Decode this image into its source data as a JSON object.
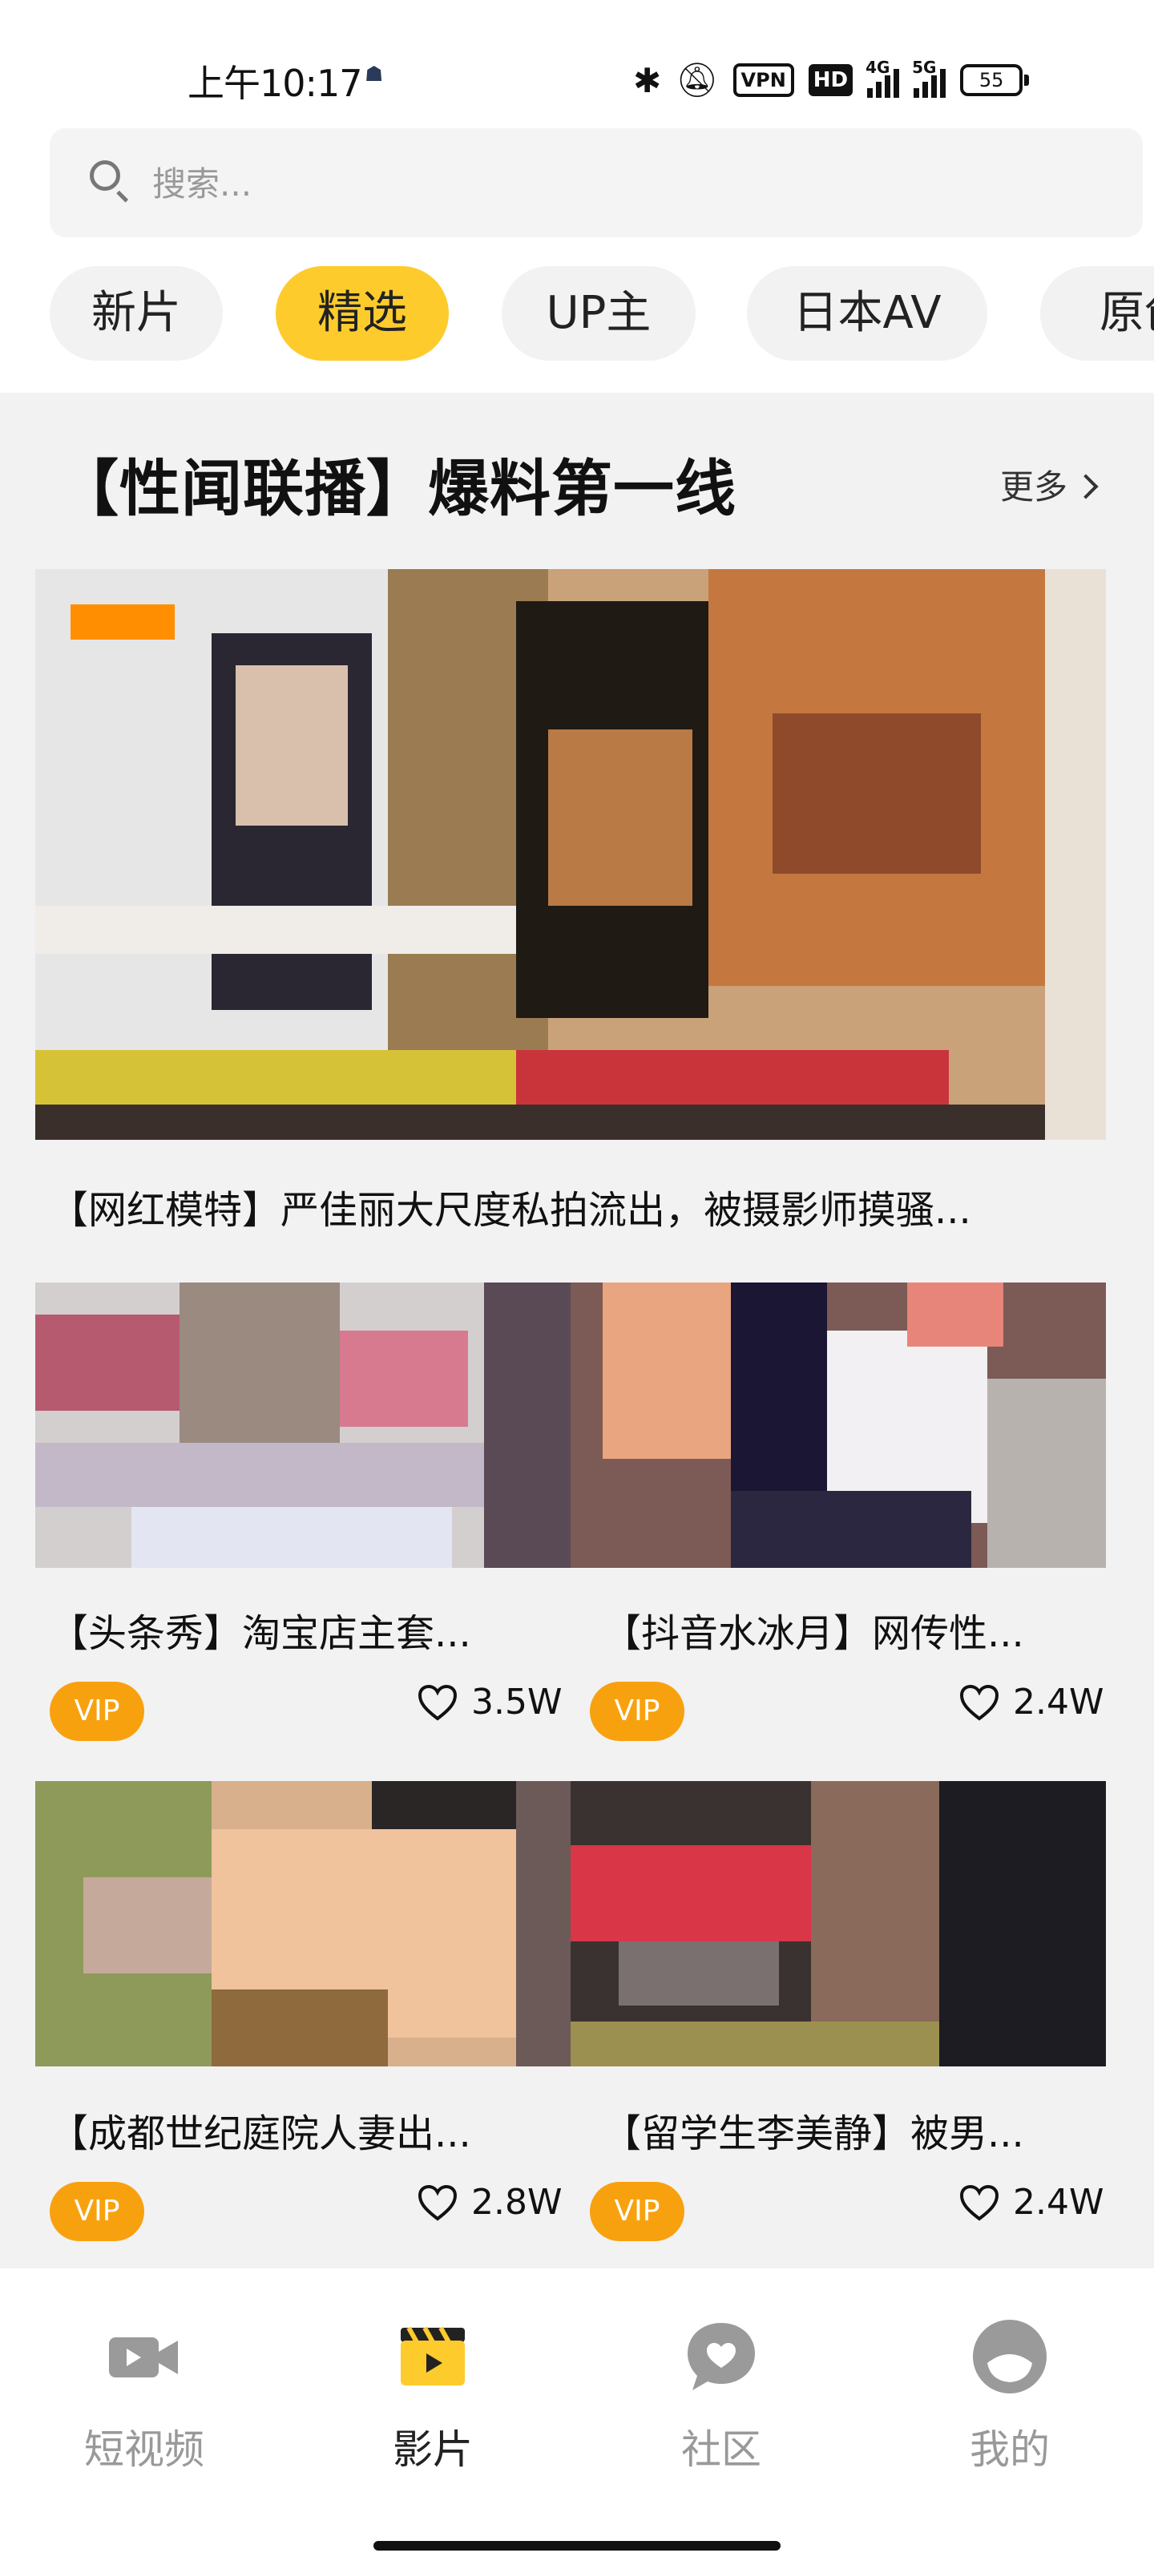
{
  "status_bar": {
    "time": "上午10:17",
    "time_glyph": "☗",
    "vpn": "VPN",
    "hd": "HD",
    "signal1": "4G",
    "signal2": "5G",
    "battery": "55"
  },
  "search": {
    "placeholder": "搜索..."
  },
  "tabs": [
    {
      "label": "新片",
      "active": false
    },
    {
      "label": "精选",
      "active": true
    },
    {
      "label": "UP主",
      "active": false
    },
    {
      "label": "日本AV",
      "active": false
    },
    {
      "label": "原创",
      "active": false
    }
  ],
  "section": {
    "title": "【性闻联播】爆料第一线",
    "more_label": "更多"
  },
  "featured": {
    "caption": "【网红模特】严佳丽大尺度私拍流出，被摄影师摸骚..."
  },
  "cards": [
    {
      "title": "【头条秀】淘宝店主套...",
      "vip": "VIP",
      "likes": "3.5W"
    },
    {
      "title": "【抖音水冰月】网传性...",
      "vip": "VIP",
      "likes": "2.4W"
    },
    {
      "title": "【成都世纪庭院人妻出...",
      "vip": "VIP",
      "likes": "2.8W"
    },
    {
      "title": "【留学生李美静】被男...",
      "vip": "VIP",
      "likes": "2.4W"
    }
  ],
  "bottom_nav": [
    {
      "label": "短视频",
      "icon": "video-camera-icon",
      "active": false
    },
    {
      "label": "影片",
      "icon": "clapperboard-icon",
      "active": true
    },
    {
      "label": "社区",
      "icon": "chat-heart-icon",
      "active": false
    },
    {
      "label": "我的",
      "icon": "profile-face-icon",
      "active": false
    }
  ],
  "colors": {
    "accent": "#fdcb2c",
    "vip": "#f8a10f",
    "nav_inactive": "#999999"
  }
}
